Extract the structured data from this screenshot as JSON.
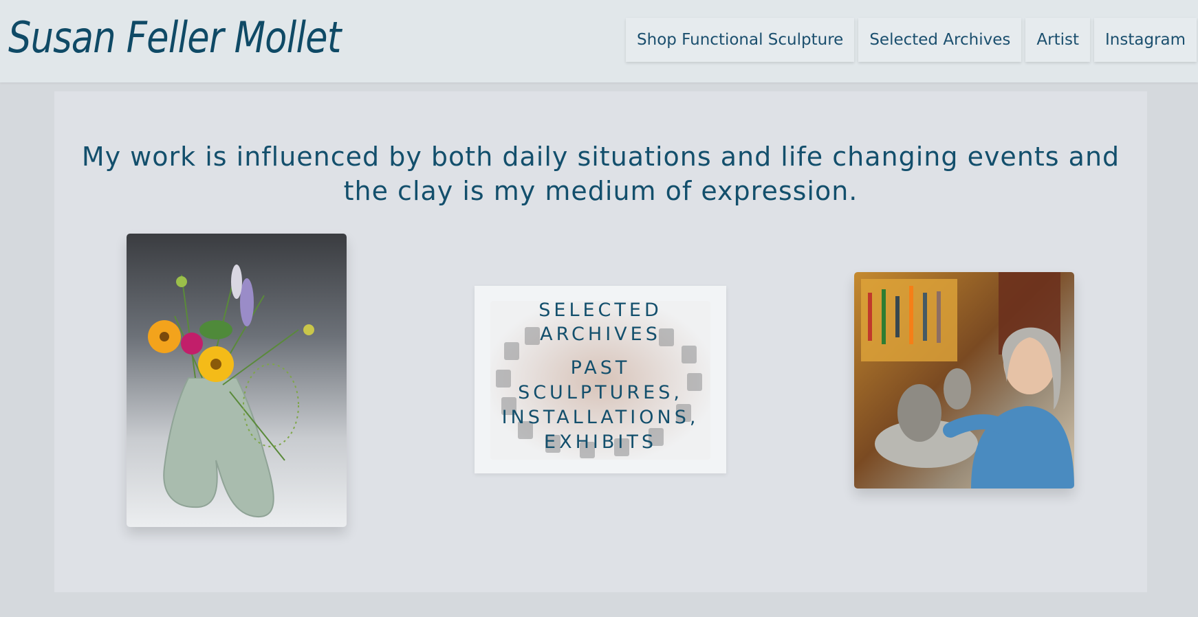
{
  "site": {
    "title": "Susan Feller Mollet",
    "brand_color": "#0f4a66",
    "page_background": "#d5d9dd",
    "header_background": "#e1e7ea"
  },
  "nav": {
    "items": [
      {
        "label": "Shop Functional Sculpture"
      },
      {
        "label": "Selected Archives"
      },
      {
        "label": "Artist"
      },
      {
        "label": "Instagram"
      }
    ]
  },
  "main": {
    "statement": "My work is influenced by both daily situations and life changing events and the clay is my medium of expression.",
    "archive_tile": {
      "heading_line1": "SELECTED",
      "heading_line2": "ARCHIVES",
      "line1": "PAST",
      "line2": "SCULPTURES,",
      "line3": "INSTALLATIONS,",
      "line4": "EXHIBITS"
    }
  }
}
